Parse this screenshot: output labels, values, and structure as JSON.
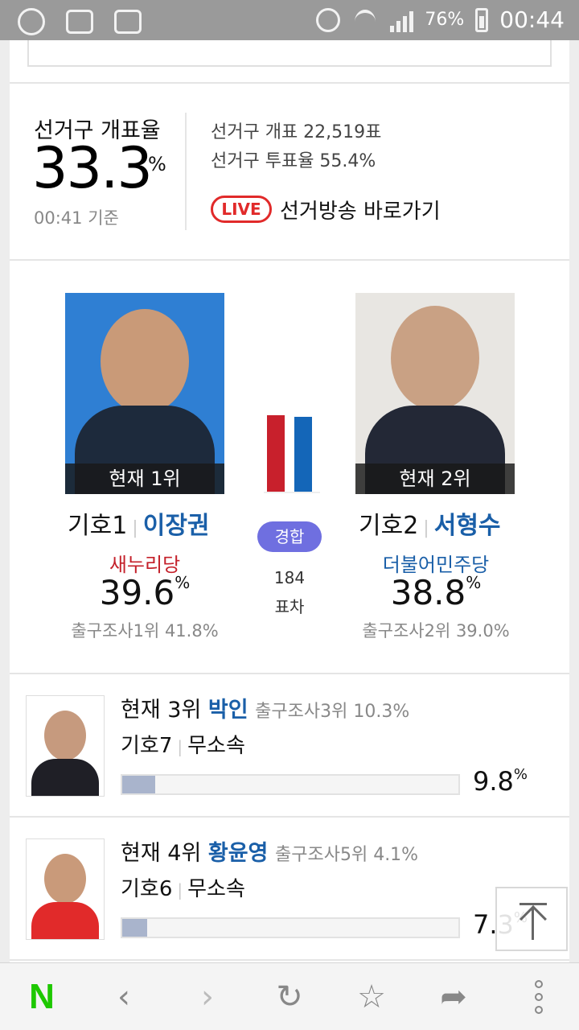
{
  "status_bar": {
    "battery": "76%",
    "time": "00:44"
  },
  "summary": {
    "count_label": "선거구 개표율",
    "count_value": "33.3",
    "count_unit": "%",
    "count_time": "00:41 기준",
    "ballots_counted": "선거구 개표  22,519표",
    "turnout": "선거구 투표율  55.4%",
    "live_badge": "LIVE",
    "live_link": "선거방송 바로가기"
  },
  "top_race": {
    "left": {
      "rank": "현재 1위",
      "number": "기호1",
      "name": "이장권",
      "party": "새누리당",
      "party_color": "#c4202a",
      "percent": "39.6",
      "percent_unit": "%",
      "exit_poll": "출구조사1위 41.8%",
      "bar_color": "#c8202c",
      "vote_share": 39.6
    },
    "right": {
      "rank": "현재 2위",
      "number": "기호2",
      "name": "서형수",
      "party": "더불어민주당",
      "party_color": "#1a5fa8",
      "percent": "38.8",
      "percent_unit": "%",
      "exit_poll": "출구조사2위 39.0%",
      "bar_color": "#1466b8",
      "vote_share": 38.8
    },
    "status_badge": "경합",
    "vote_gap": "184",
    "vote_gap_label": "표차"
  },
  "others": [
    {
      "rank": "현재 3위",
      "name": "박인",
      "exit_poll": "출구조사3위 10.3%",
      "number": "기호7",
      "party": "무소속",
      "percent": "9.8",
      "percent_unit": "%",
      "share": 9.8
    },
    {
      "rank": "현재 4위",
      "name": "황윤영",
      "exit_poll": "출구조사5위 4.1%",
      "number": "기호6",
      "party": "무소속",
      "percent": "7.3",
      "percent_unit": "%",
      "share": 7.3
    }
  ],
  "bottom_nav": {
    "home": "N",
    "back_icon": "chevron-left-icon",
    "forward_icon": "chevron-right-icon",
    "refresh_icon": "refresh-icon",
    "bookmark_icon": "star-icon",
    "share_icon": "share-icon",
    "menu_icon": "more-vertical-icon"
  }
}
